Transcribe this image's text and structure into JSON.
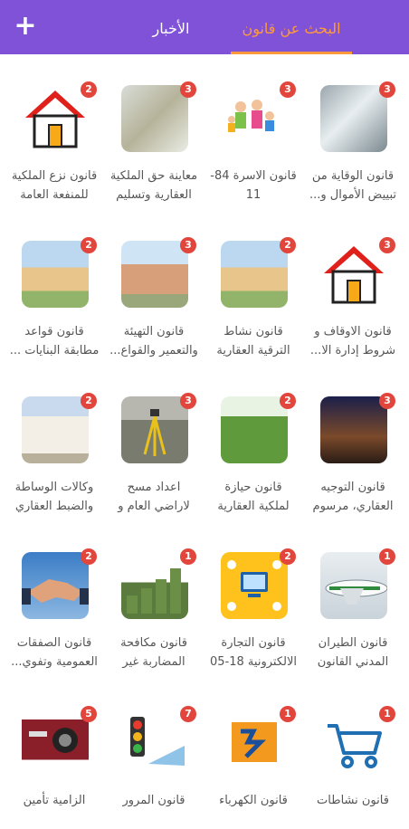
{
  "header": {
    "tab_active": "البحث عن قانون",
    "tab_news": "الأخبار"
  },
  "colors": {
    "header_bg": "#7f52d8",
    "accent": "#ff9a3c",
    "badge": "#e2453b"
  },
  "items": [
    {
      "title": "قانون الوقاية من تبييض الأموال و...",
      "count": "3"
    },
    {
      "title": "قانون الاسرة 84-11",
      "count": "3"
    },
    {
      "title": "معاينة حق الملكية العقارية وتسليم ...",
      "count": "3"
    },
    {
      "title": "قانون نزع الملكية للمنفعة العامة",
      "count": "2"
    },
    {
      "title": "قانون الاوقاف و شروط إدارة الا...",
      "count": "3"
    },
    {
      "title": "قانون نشاط الترقية العقارية",
      "count": "2"
    },
    {
      "title": "قانون التهيئة والتعمير والقواع...",
      "count": "3"
    },
    {
      "title": "قانون قواعد مطابقة البنايات ...",
      "count": "2"
    },
    {
      "title": "قانون التوجيه العقاري، مرسوم ا...",
      "count": "3"
    },
    {
      "title": "قانون حيازة لملكية العقارية ال...",
      "count": "2"
    },
    {
      "title": "اعداد مسح لاراضي العام و ت...",
      "count": "3"
    },
    {
      "title": "وكالات الوساطة والضبط العقاري",
      "count": "2"
    },
    {
      "title": "قانون الطيران المدني القانون ...9",
      "count": "1"
    },
    {
      "title": "قانون التجارة الالكترونية 18-05",
      "count": "2"
    },
    {
      "title": "قانون مكافحة المضاربة غير الم...",
      "count": "1"
    },
    {
      "title": "قانون الصفقات العمومية وتفوي...",
      "count": "2"
    },
    {
      "title": "قانون نشاطات",
      "count": "1"
    },
    {
      "title": "قانون الكهرباء",
      "count": "1"
    },
    {
      "title": "قانون المرور",
      "count": "7"
    },
    {
      "title": "الزامية تأمين",
      "count": "5"
    }
  ]
}
